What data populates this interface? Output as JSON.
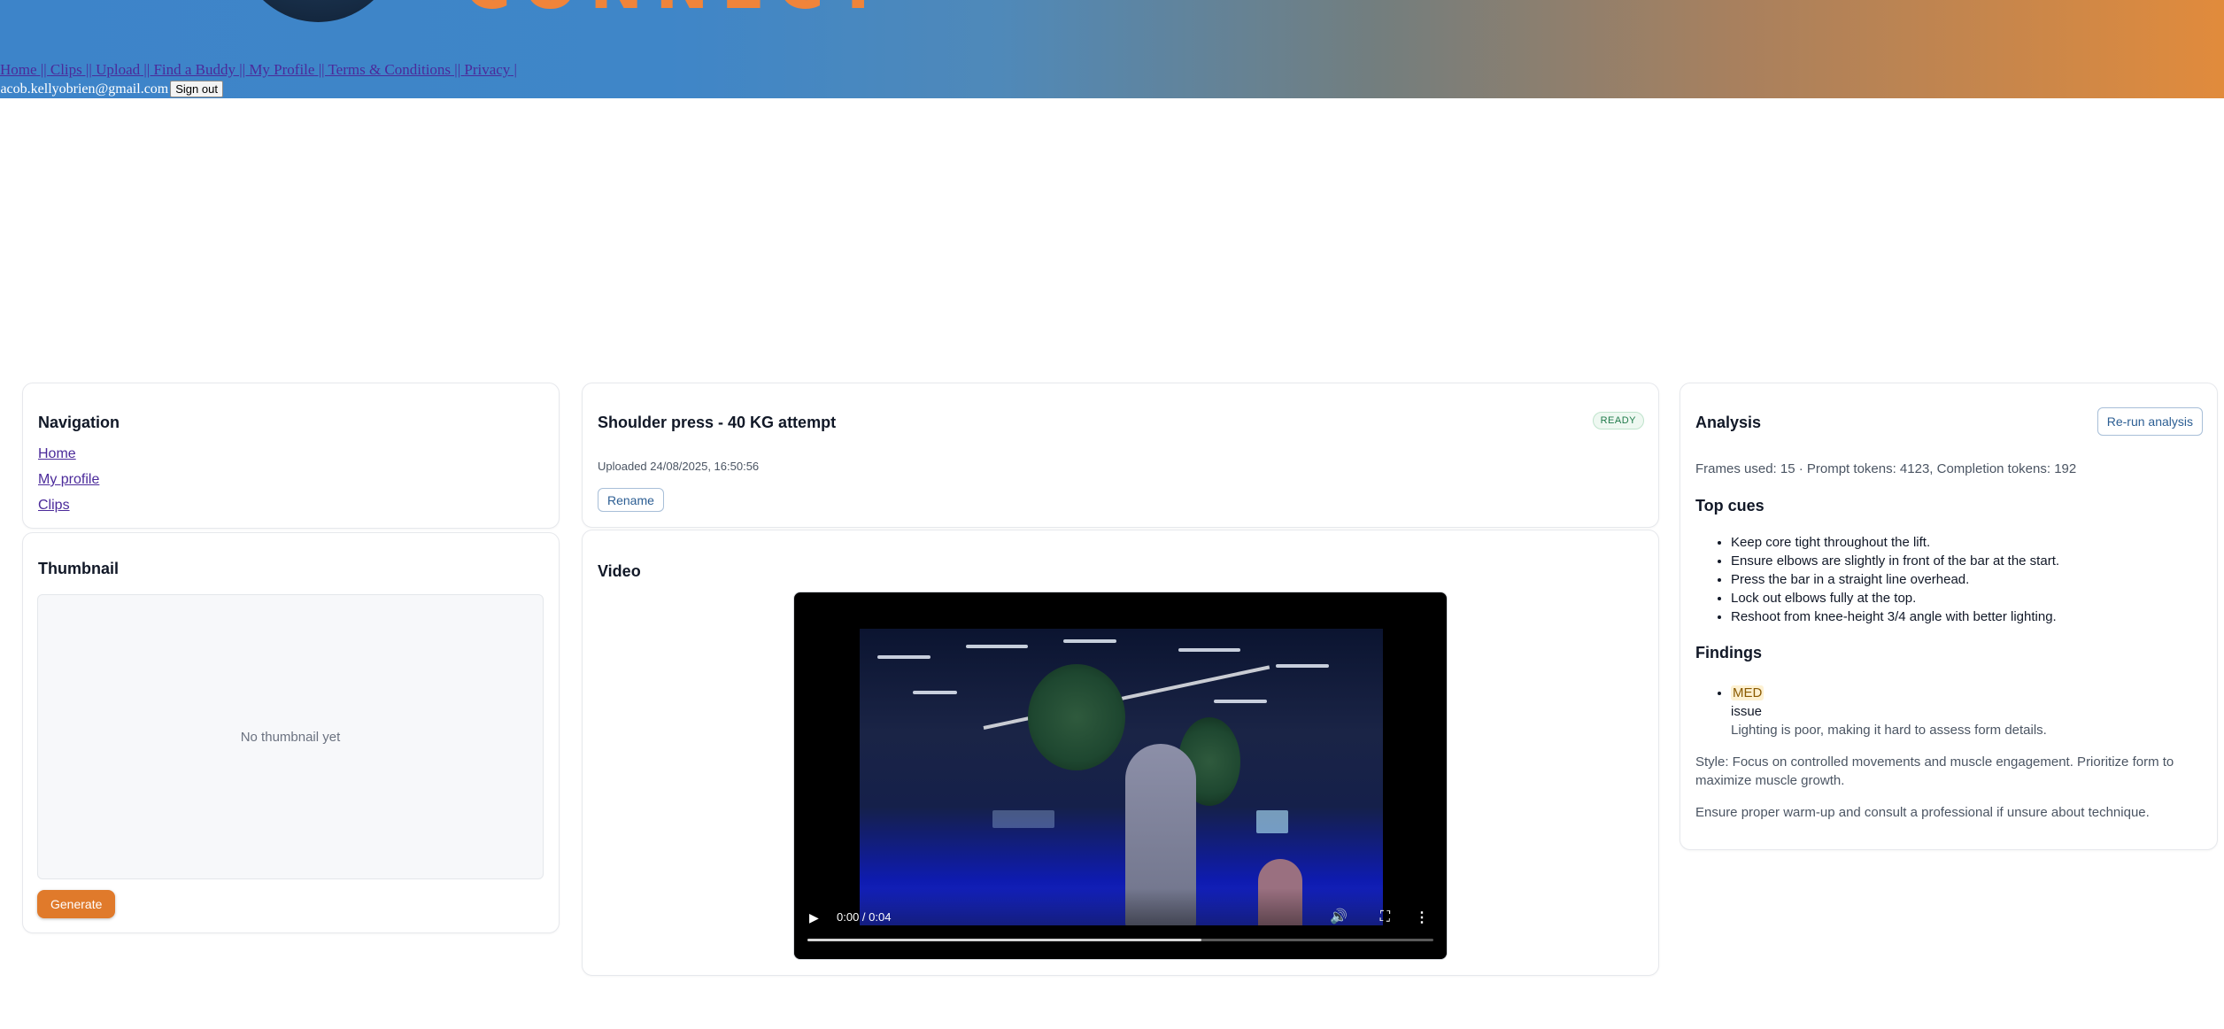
{
  "header": {
    "logo_text": "CONNECT",
    "nav": [
      "Home",
      "Clips",
      "Upload",
      "Find a Buddy",
      "My Profile",
      "Terms & Conditions",
      "Privacy"
    ],
    "separator": " || ",
    "trailing": " |",
    "user_email": "jacob.kellyobrien@gmail.com",
    "sign_out": "Sign out"
  },
  "navigation": {
    "title": "Navigation",
    "links": [
      "Home",
      "My profile",
      "Clips"
    ]
  },
  "thumbnail": {
    "title": "Thumbnail",
    "empty_text": "No thumbnail yet",
    "generate_label": "Generate"
  },
  "clip": {
    "title": "Shoulder press - 40 KG attempt",
    "status": "READY",
    "uploaded": "Uploaded 24/08/2025, 16:50:56",
    "rename_label": "Rename"
  },
  "video": {
    "title": "Video",
    "time": "0:00 / 0:04",
    "buffered_fraction": 0.63
  },
  "analysis": {
    "title": "Analysis",
    "rerun_label": "Re-run analysis",
    "stats": "Frames used: 15 · Prompt tokens: 4123, Completion tokens: 192",
    "top_cues_title": "Top cues",
    "cues": [
      "Keep core tight throughout the lift.",
      "Ensure elbows are slightly in front of the bar at the start.",
      "Press the bar in a straight line overhead.",
      "Lock out elbows fully at the top.",
      "Reshoot from knee-height 3/4 angle with better lighting."
    ],
    "findings_title": "Findings",
    "finding": {
      "severity": "MED",
      "type": "issue",
      "detail": "Lighting is poor, making it hard to assess form details."
    },
    "style": "Style: Focus on controlled movements and muscle engagement. Prioritize form to maximize muscle growth.",
    "safety": "Ensure proper warm-up and consult a professional if unsure about technique."
  }
}
